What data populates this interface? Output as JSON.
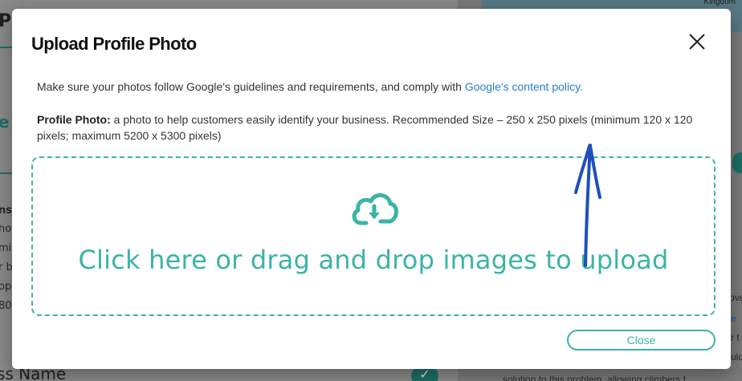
{
  "background": {
    "left_title_fragment": "Pi",
    "left_teal_fragment": "e",
    "left_text_fragments": [
      "ns",
      "hot",
      "mi",
      "r b",
      "op",
      "80"
    ],
    "left_bottom_fragment": "ss Name",
    "right_map_label": "Kingdom",
    "right_text_fragments": [
      "ove",
      "e",
      "r t",
      "ulo",
      "solution to this problem, allowing climbers t"
    ]
  },
  "modal": {
    "title": "Upload Profile Photo",
    "intro_text": "Make sure your photos follow Google’s guidelines and requirements, and comply with ",
    "intro_link": "Google's content policy.",
    "desc_label": "Profile Photo:",
    "desc_text": " a photo to help customers easily identify your business. Recommended Size – 250 x 250 pixels (minimum 120 x 120 pixels; maximum 5200 x 5300 pixels)",
    "dropzone_text": "Click here or drag and drop images to upload",
    "close_button": "Close",
    "icons": {
      "close": "close-icon",
      "upload": "cloud-upload-icon"
    },
    "colors": {
      "accent": "#3bb4a5",
      "link": "#2a7dc1",
      "annotation_arrow": "#1f4fbf"
    }
  }
}
